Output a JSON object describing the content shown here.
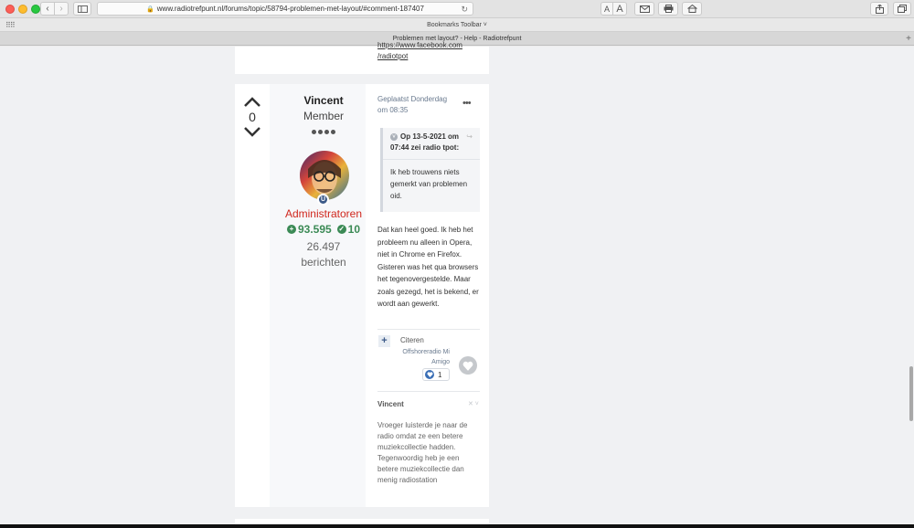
{
  "browser": {
    "url": "www.radiotrefpunt.nl/forums/topic/58794-problemen-met-layout/#comment-187407",
    "bookmarks_label": "Bookmarks Toolbar ˅",
    "tab_title": "Problemen met layout? - Help - Radiotrefpunt",
    "font_small": "A",
    "font_large": "A",
    "colors": {
      "close": "#fc5f57",
      "minimize": "#fdbc2e",
      "zoom": "#28c840"
    }
  },
  "previous_post": {
    "links": [
      "https://www.facebook.com",
      "/radiotpot"
    ]
  },
  "post": {
    "vote_count": "0",
    "author": {
      "name": "Vincent",
      "rank": "Member",
      "rank_pips": 4,
      "badge": "U",
      "group": "Administratoren",
      "reputation": "93.595",
      "solutions": "10",
      "post_count": "26.497",
      "posts_label": "berichten"
    },
    "date": "Geplaatst Donderdag om 08:35",
    "menu_label": "•••",
    "quote": {
      "header": "Op 13-5-2021 om 07:44 zei radio tpot:",
      "text": "Ik heb trouwens niets gemerkt van problemen oid."
    },
    "body": "Dat kan heel goed. Ik heb het probleem nu alleen in Opera, niet in Chrome en Firefox. Gisteren was het qua browsers het tegenovergestelde. Maar zoals gezegd, het is bekend, er wordt aan gewerkt.",
    "actions": {
      "multiquote_label": "+",
      "quote_label": "Citeren"
    },
    "reactions": {
      "user": "Offshoreradio Mi Amigo",
      "count": "1"
    },
    "signature": {
      "name": "Vincent",
      "close_label": "✕ ˅",
      "text": "Vroeger luisterde je naar de radio omdat ze een betere muziekcollectie hadden. Tegenwoordig heb je een betere muziekcollectie dan menig radiostation"
    }
  }
}
